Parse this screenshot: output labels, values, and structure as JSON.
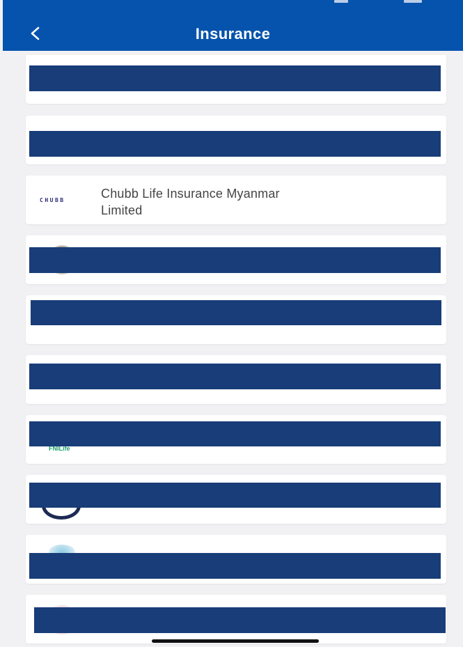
{
  "header": {
    "title": "Insurance",
    "back_label": "<"
  },
  "colors": {
    "header_bg": "#0653ad",
    "redaction": "#183d78",
    "page_bg": "#f1f1f3"
  },
  "insurers": [
    {
      "name": ""
    },
    {
      "name": ""
    },
    {
      "name": "Chubb Life Insurance Myanmar Limited",
      "logo_text": "CHUBB"
    },
    {
      "name": ""
    },
    {
      "name": ""
    },
    {
      "name": ""
    },
    {
      "name": "",
      "logo_text": "FNILife"
    },
    {
      "name": ""
    },
    {
      "name": ""
    },
    {
      "name": ""
    }
  ]
}
